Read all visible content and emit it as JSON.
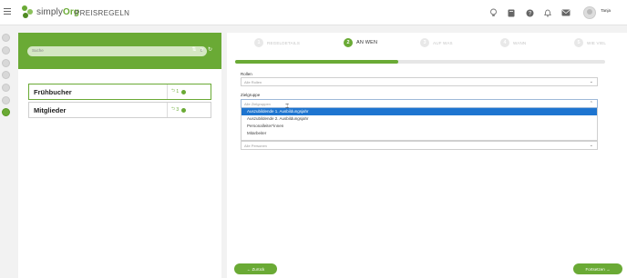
{
  "app": {
    "logo_prefix": "simply",
    "logo_suffix": "Org",
    "page_title": "PREISREGELN",
    "user_name": "Tanja"
  },
  "left_panel": {
    "search_placeholder": "Suche",
    "items": [
      {
        "name": "Frühbucher",
        "count": "1",
        "selected": true
      },
      {
        "name": "Mitglieder",
        "count": "3",
        "selected": false
      }
    ]
  },
  "wizard": {
    "steps": [
      {
        "number": "1",
        "label": "REGELDETAILS",
        "active": false
      },
      {
        "number": "2",
        "label": "AN WEN",
        "active": true
      },
      {
        "number": "3",
        "label": "AUF WAS",
        "active": false
      },
      {
        "number": "4",
        "label": "WANN",
        "active": false
      },
      {
        "number": "5",
        "label": "WIE VIEL",
        "active": false
      }
    ],
    "progress_percent": 44
  },
  "form": {
    "rollen_label": "Rollen",
    "rollen_value": "Alle Rollen",
    "zielgruppe_label": "Zielgruppe",
    "zielgruppe_value": "Alle Zielgruppen",
    "zielgruppe_options": [
      "Auszubildende 1. Ausbildungsjahr",
      "Auszubildende 2. Ausbildungsjahr",
      "Personalleiter*innen",
      "Mitarbeiter"
    ],
    "personen_value": "Alle Personen"
  },
  "buttons": {
    "back": "Zurück",
    "next": "Fortsetzen"
  },
  "colors": {
    "accent": "#6aaa35",
    "highlight": "#1e75d0"
  }
}
